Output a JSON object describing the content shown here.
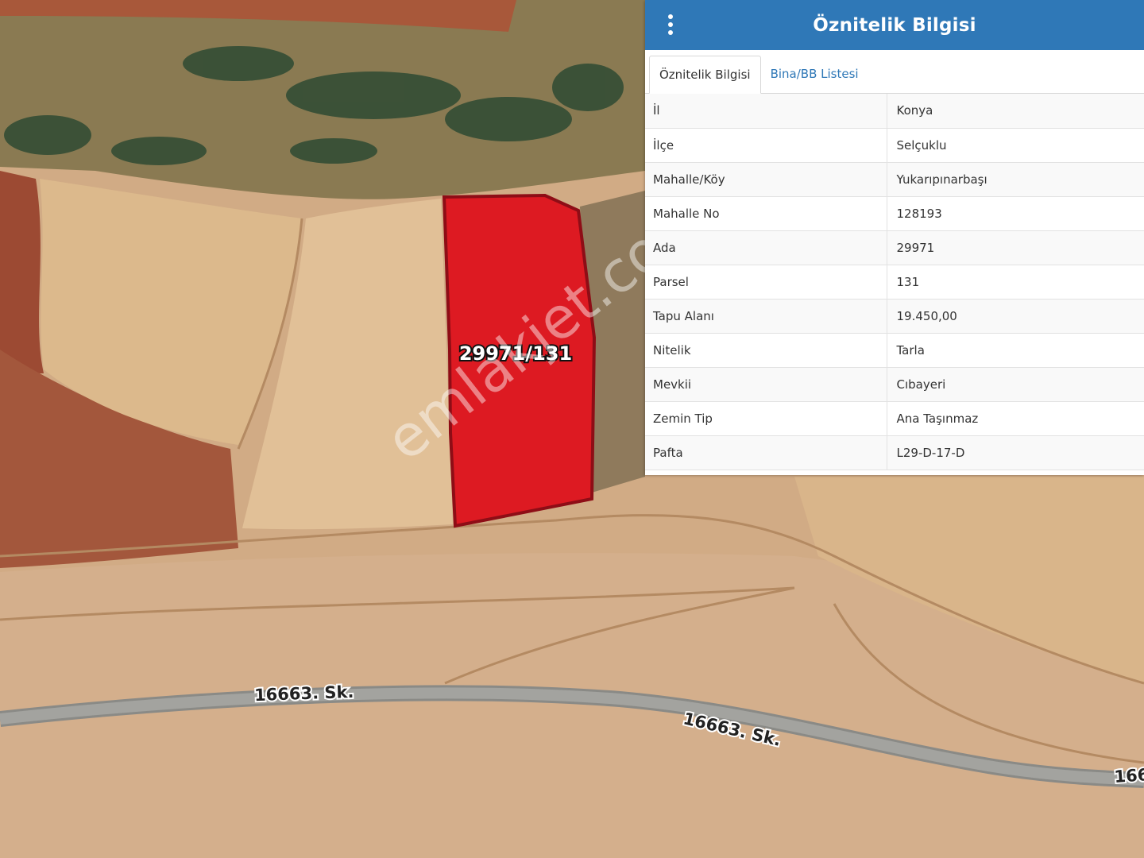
{
  "map": {
    "parcel_label": "29971/131",
    "road_labels": [
      "16663. Sk.",
      "16663. Sk.",
      "166"
    ],
    "watermark": "emlakjet.com",
    "parcel_color": "#dd1a22"
  },
  "panel": {
    "title": "Öznitelik Bilgisi",
    "accent_color": "#2f78b7",
    "menu_icon": "vertical-ellipsis-icon",
    "tabs": [
      {
        "label": "Öznitelik Bilgisi",
        "active": true
      },
      {
        "label": "Bina/BB Listesi",
        "active": false
      }
    ],
    "rows": [
      {
        "key": "İl",
        "value": "Konya"
      },
      {
        "key": "İlçe",
        "value": "Selçuklu"
      },
      {
        "key": "Mahalle/Köy",
        "value": "Yukarıpınarbaşı"
      },
      {
        "key": "Mahalle No",
        "value": "128193"
      },
      {
        "key": "Ada",
        "value": "29971"
      },
      {
        "key": "Parsel",
        "value": "131"
      },
      {
        "key": "Tapu Alanı",
        "value": "19.450,00"
      },
      {
        "key": "Nitelik",
        "value": "Tarla"
      },
      {
        "key": "Mevkii",
        "value": "Cıbayeri"
      },
      {
        "key": "Zemin Tip",
        "value": "Ana Taşınmaz"
      },
      {
        "key": "Pafta",
        "value": "L29-D-17-D"
      }
    ]
  }
}
